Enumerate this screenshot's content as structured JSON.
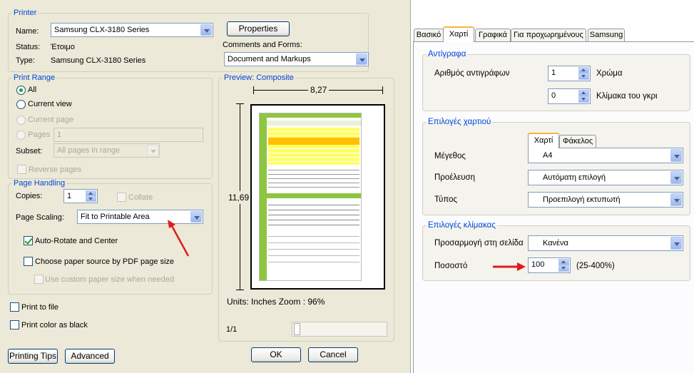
{
  "left": {
    "printer": {
      "legend": "Printer",
      "name_label": "Name:",
      "name_value": "Samsung CLX-3180 Series",
      "properties": "Properties",
      "status_label": "Status:",
      "status_value": "Έτοιμο",
      "type_label": "Type:",
      "type_value": "Samsung CLX-3180 Series",
      "comments_label": "Comments and Forms:",
      "comments_value": "Document and Markups"
    },
    "range": {
      "legend": "Print Range",
      "all": "All",
      "current_view": "Current view",
      "current_page": "Current page",
      "pages": "Pages",
      "pages_value": "1",
      "subset_label": "Subset:",
      "subset_value": "All pages in range",
      "reverse": "Reverse pages"
    },
    "handling": {
      "legend": "Page Handling",
      "copies_label": "Copies:",
      "copies_value": "1",
      "collate": "Collate",
      "scaling_label": "Page Scaling:",
      "scaling_value": "Fit to Printable Area",
      "auto_rotate": "Auto-Rotate and Center",
      "choose_source": "Choose paper source by PDF page size",
      "custom_size": "Use custom paper size when needed"
    },
    "print_to_file": "Print to file",
    "print_black": "Print color as black",
    "printing_tips": "Printing Tips",
    "advanced": "Advanced",
    "preview": {
      "legend": "Preview: Composite",
      "width": "8,27",
      "height": "11,69",
      "units": "Units: Inches Zoom :  96%",
      "page": "1/1"
    },
    "ok": "OK",
    "cancel": "Cancel"
  },
  "right": {
    "tabs": [
      "Βασικό",
      "Χαρτί",
      "Γραφικά",
      "Για προχωρημένους",
      "Samsung"
    ],
    "copies": {
      "legend": "Αντίγραφα",
      "count_label": "Αριθμός αντιγράφων",
      "count_value": "1",
      "color_label": "Χρώμα",
      "gray_value": "0",
      "gray_label": "Κλίμακα του γκρι"
    },
    "paper": {
      "legend": "Επιλογές χαρτιού",
      "tab_paper": "Χαρτί",
      "tab_envelope": "Φάκελος",
      "size_label": "Μέγεθος",
      "size_value": "A4",
      "source_label": "Προέλευση",
      "source_value": "Αυτόματη επιλογή",
      "type_label": "Τύπος",
      "type_value": "Προεπιλογή εκτυπωτή"
    },
    "scale": {
      "legend": "Επιλογές κλίμακας",
      "fit_label": "Προσαρμογή στη σελίδα",
      "fit_value": "Κανένα",
      "percent_label": "Ποσοστό",
      "percent_value": "100",
      "percent_range": "(25-400%)"
    }
  },
  "colors": {
    "legend": "#0046d5",
    "arrow": "#e01b1b",
    "doc_green": "#8dc63f",
    "doc_yellow": "#ffff66",
    "doc_orange": "#ffc000"
  }
}
